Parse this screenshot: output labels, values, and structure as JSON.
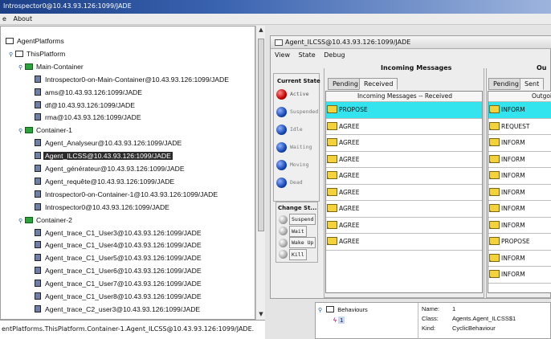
{
  "window": {
    "title": "Introspector0@10.43.93.126:1099/JADE"
  },
  "menu": {
    "about_label": "About",
    "leading_mark": "e"
  },
  "tree": {
    "nodes": [
      {
        "label": "AgentPlatforms",
        "icon": "folder-icon",
        "toggle": ""
      },
      {
        "label": "ThisPlatform",
        "icon": "folder-icon",
        "toggle": "⚲"
      },
      {
        "label": "Main-Container",
        "icon": "green-folder-icon",
        "toggle": "⚲"
      },
      {
        "label": "Introspector0-on-Main-Container@10.43.93.126:1099/JADE",
        "icon": "agent-icon"
      },
      {
        "label": "ams@10.43.93.126:1099/JADE",
        "icon": "agent-icon"
      },
      {
        "label": "df@10.43.93.126:1099/JADE",
        "icon": "agent-icon"
      },
      {
        "label": "rma@10.43.93.126:1099/JADE",
        "icon": "agent-icon"
      },
      {
        "label": "Container-1",
        "icon": "green-folder-icon",
        "toggle": "⚲"
      },
      {
        "label": "Agent_Analyseur@10.43.93.126:1099/JADE",
        "icon": "agent-icon"
      },
      {
        "label": "Agent_ILCSS@10.43.93.126:1099/JADE",
        "icon": "agent-icon",
        "selected": true
      },
      {
        "label": "Agent_générateur@10.43.93.126:1099/JADE",
        "icon": "agent-icon"
      },
      {
        "label": "Agent_requête@10.43.93.126:1099/JADE",
        "icon": "agent-icon"
      },
      {
        "label": "Introspector0-on-Container-1@10.43.93.126:1099/JADE",
        "icon": "agent-icon"
      },
      {
        "label": "Introspector0@10.43.93.126:1099/JADE",
        "icon": "agent-icon"
      },
      {
        "label": "Container-2",
        "icon": "green-folder-icon",
        "toggle": "⚲"
      },
      {
        "label": "Agent_trace_C1_User3@10.43.93.126:1099/JADE",
        "icon": "agent-icon"
      },
      {
        "label": "Agent_trace_C1_User4@10.43.93.126:1099/JADE",
        "icon": "agent-icon"
      },
      {
        "label": "Agent_trace_C1_User5@10.43.93.126:1099/JADE",
        "icon": "agent-icon"
      },
      {
        "label": "Agent_trace_C1_User6@10.43.93.126:1099/JADE",
        "icon": "agent-icon"
      },
      {
        "label": "Agent_trace_C1_User7@10.43.93.126:1099/JADE",
        "icon": "agent-icon"
      },
      {
        "label": "Agent_trace_C1_User8@10.43.93.126:1099/JADE",
        "icon": "agent-icon"
      },
      {
        "label": "Agent_trace_C2_user3@10.43.93.126:1099/JADE",
        "icon": "agent-icon"
      }
    ]
  },
  "status": {
    "path": "entPlatforms.ThisPlatform.Container-1.Agent_ILCSS@10.43.93.126:1099/JADE."
  },
  "agent_window": {
    "title": "Agent_ILCSS@10.43.93.126:1099/JADE",
    "menu": {
      "view": "View",
      "state": "State",
      "debug": "Debug"
    },
    "current_state_label": "Current State",
    "states": [
      {
        "label": "Active",
        "color": "red"
      },
      {
        "label": "Suspended",
        "color": "blue"
      },
      {
        "label": "Idle",
        "color": "blue"
      },
      {
        "label": "Waiting",
        "color": "blue"
      },
      {
        "label": "Moving",
        "color": "blue"
      },
      {
        "label": "Dead",
        "color": "blue"
      }
    ],
    "change_state_label": "Change St...",
    "change_actions": [
      "Suspend",
      "Wait",
      "Wake Up",
      "Kill"
    ],
    "incoming": {
      "group_label": "Incoming Messages",
      "tabs": [
        "Pending",
        "Received"
      ],
      "list_header": "Incoming Messages -- Received",
      "messages": [
        "PROPOSE",
        "AGREE",
        "AGREE",
        "AGREE",
        "AGREE",
        "AGREE",
        "AGREE",
        "AGREE",
        "AGREE"
      ]
    },
    "outgoing": {
      "group_label": "Ou",
      "tabs": [
        "Pending",
        "Sent"
      ],
      "list_header": "Outgoi",
      "messages": [
        "INFORM",
        "REQUEST",
        "INFORM",
        "INFORM",
        "INFORM",
        "INFORM",
        "INFORM",
        "INFORM",
        "PROPOSE",
        "INFORM",
        "INFORM"
      ]
    }
  },
  "behaviours": {
    "root_label": "Behaviours",
    "child_label": "1",
    "name_key": "Name:",
    "name_value": "1",
    "class_key": "Class:",
    "class_value": "Agents.Agent_ILCSS$1",
    "kind_key": "Kind:",
    "kind_value": "CyclicBehaviour"
  },
  "colors": {
    "highlight": "#33e4ee",
    "selection": "#2b2b2b",
    "titlebar": "#1c3f86"
  }
}
